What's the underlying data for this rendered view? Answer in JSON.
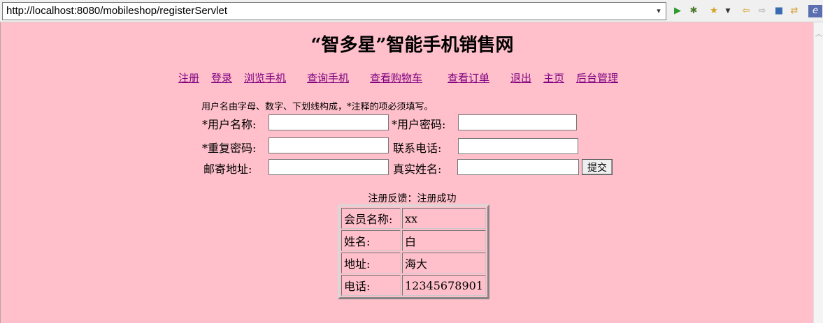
{
  "browser": {
    "url": "http://localhost:8080/mobileshop/registerServlet"
  },
  "page": {
    "title": "“智多星”智能手机销售网",
    "nav": [
      "注册",
      "登录",
      "浏览手机",
      "查询手机",
      "查看购物车",
      "查看订单",
      "退出",
      "主页",
      "后台管理"
    ],
    "hint": "用户名由字母、数字、下划线构成，*注释的项必须填写。",
    "form": {
      "username_label": "*用户名称:",
      "password_label": "*用户密码:",
      "repeat_password_label": "*重复密码:",
      "phone_label": "联系电话:",
      "address_label": "邮寄地址:",
      "realname_label": "真实姓名:",
      "submit_label": "提交"
    },
    "feedback": "注册反馈：注册成功",
    "result": [
      {
        "key": "会员名称:",
        "value": "xx"
      },
      {
        "key": "姓名:",
        "value": "白"
      },
      {
        "key": "地址:",
        "value": "海大"
      },
      {
        "key": "电话:",
        "value": "12345678901"
      }
    ]
  },
  "colors": {
    "page_background": "#ffc0cb",
    "link": "#800080"
  }
}
